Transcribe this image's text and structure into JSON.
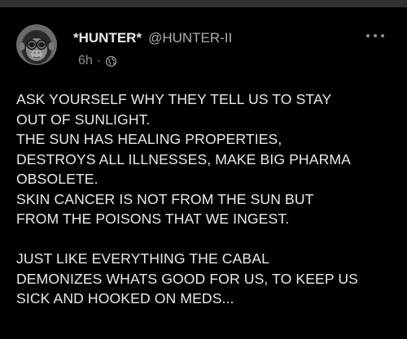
{
  "header": {
    "display_name": "*HUNTER*",
    "handle": "@HUNTER-II",
    "time": "6h",
    "separator": "·",
    "visibility_icon": "globe-icon",
    "more_icon": "more-horizontal-icon",
    "avatar_icon": "chimpanzee-avatar"
  },
  "tweet": {
    "lines": [
      "ASK YOURSELF WHY THEY TELL US TO STAY",
      "OUT OF SUNLIGHT.",
      "THE SUN HAS HEALING PROPERTIES,",
      "DESTROYS ALL ILLNESSES, MAKE BIG PHARMA",
      "OBSOLETE.",
      "SKIN CANCER IS NOT FROM THE SUN BUT",
      "FROM THE POISONS THAT WE INGEST.",
      "",
      "JUST LIKE EVERYTHING THE CABAL",
      "DEMONIZES WHATS GOOD FOR US, TO KEEP US",
      "SICK AND HOOKED ON MEDS..."
    ]
  },
  "colors": {
    "background": "#000000",
    "text": "#e7e9ea",
    "secondary": "#8b9096"
  }
}
